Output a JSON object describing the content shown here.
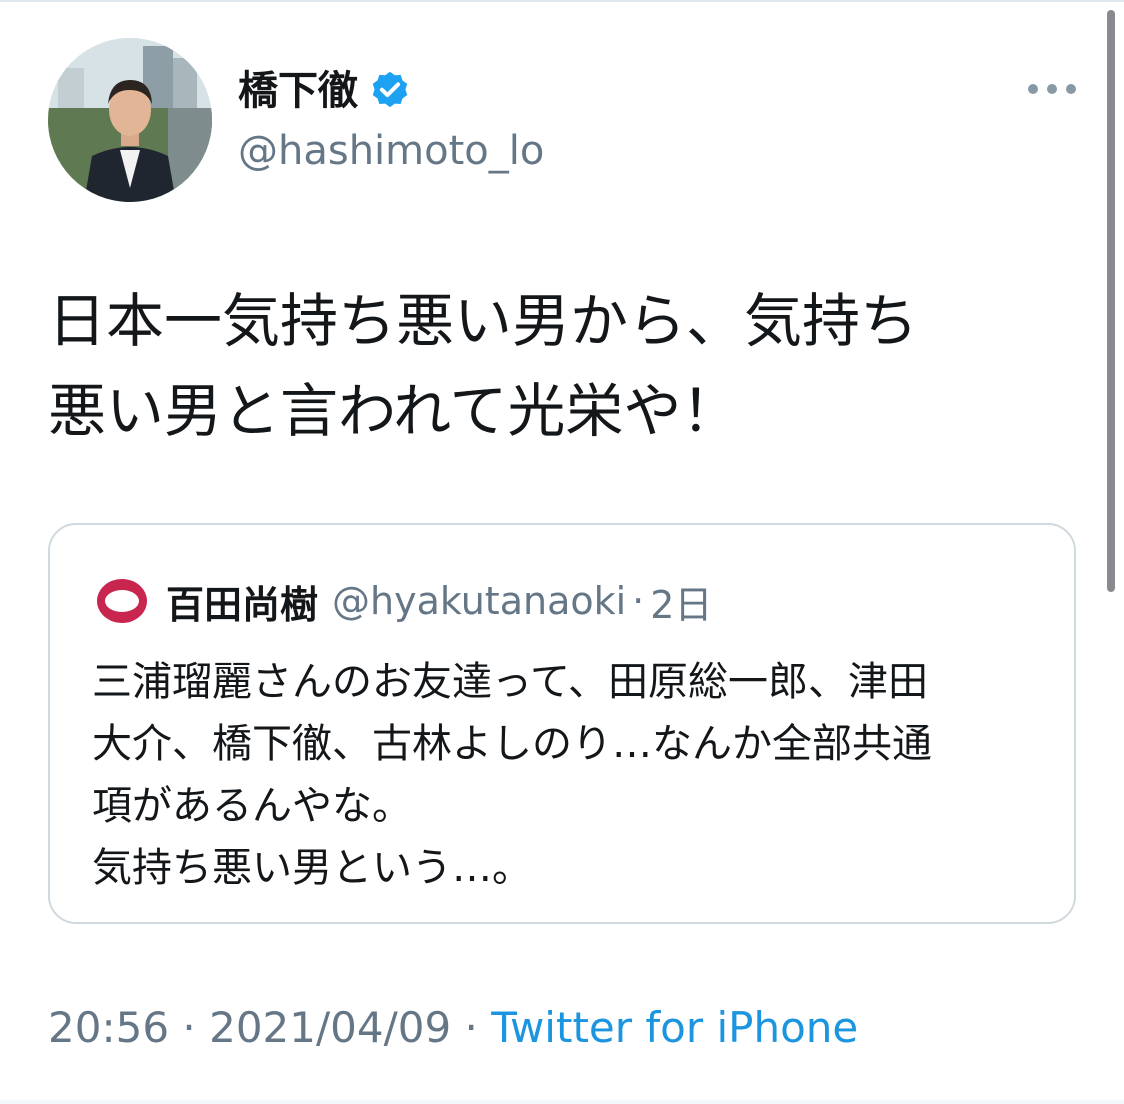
{
  "tweet": {
    "author": {
      "name": "橋下徹",
      "handle": "@hashimoto_lo",
      "verified": true,
      "avatar_icon": "profile-photo"
    },
    "more_icon": "more-horizontal-icon",
    "text_lines": [
      "日本一気持ち悪い男から、気持ち",
      "悪い男と言われて光栄や！"
    ],
    "quoted": {
      "author_name": "百田尚樹",
      "author_handle": "@hyakutanaoki",
      "separator": "·",
      "time": "2日",
      "avatar_icon": "red-ring-avatar",
      "text_lines": [
        "三浦瑠麗さんのお友達って、田原総一郎、津田",
        "大介、橋下徹、古林よしのり…なんか全部共通",
        "項があるんやな。",
        "気持ち悪い男という…。"
      ]
    },
    "timestamp": {
      "time": "20:56",
      "separator1": " · ",
      "date": "2021/04/09",
      "separator2": " · ",
      "source": "Twitter for iPhone"
    }
  },
  "colors": {
    "text": "#14171a",
    "secondary": "#657786",
    "link": "#1b95e0",
    "verified": "#1da1f2",
    "border": "#cfd9de",
    "quote_avatar_ring": "#c8264f"
  }
}
